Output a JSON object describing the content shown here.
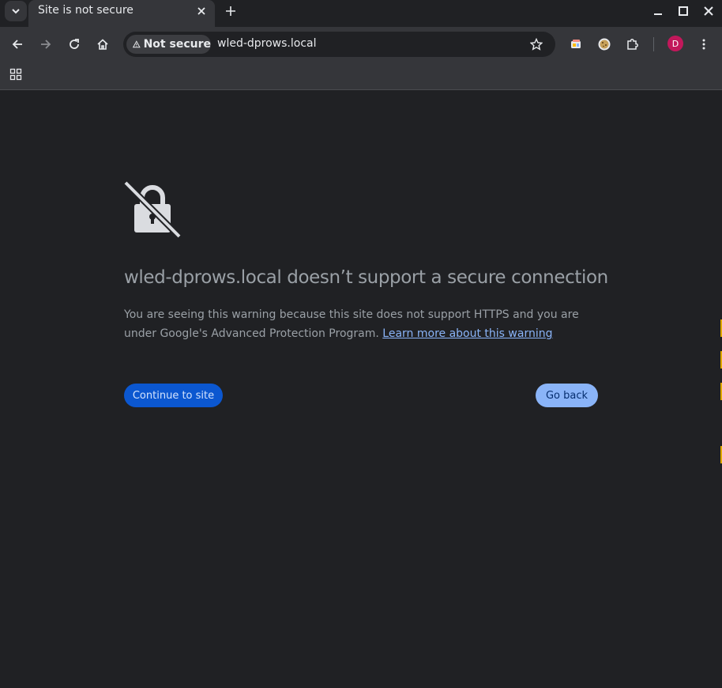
{
  "tab": {
    "title": "Site is not secure"
  },
  "omnibox": {
    "security_label": "Not secure",
    "url": "wled-dprows.local"
  },
  "profile": {
    "initial": "D",
    "color": "#c2185b"
  },
  "page": {
    "headline": "wled-dprows.local doesn’t support a secure connection",
    "explanation": "You are seeing this warning because this site does not support HTTPS and you are under Google's Advanced Protection Program.",
    "learn_more": "Learn more about this warning",
    "continue_label": "Continue to site",
    "back_label": "Go back"
  },
  "icons": {
    "tab_search": "chevron-down-icon",
    "tab_close": "close-icon",
    "new_tab": "plus-icon",
    "minimize": "minimize-icon",
    "maximize": "maximize-icon",
    "close": "close-icon",
    "back": "arrow-left-icon",
    "forward": "arrow-right-icon",
    "reload": "reload-icon",
    "home": "home-icon",
    "warning": "warning-icon",
    "bookmark": "star-icon",
    "extension_1": "media-icon",
    "extension_2": "cookie-icon",
    "extensions": "puzzle-icon",
    "menu": "kebab-menu-icon",
    "apps": "apps-grid-icon",
    "hero": "broken-lock-icon"
  },
  "colors": {
    "background": "#202124",
    "primary_button": "#0b57d0",
    "secondary_button": "#8ab4f8",
    "link": "#8ab4f8"
  }
}
